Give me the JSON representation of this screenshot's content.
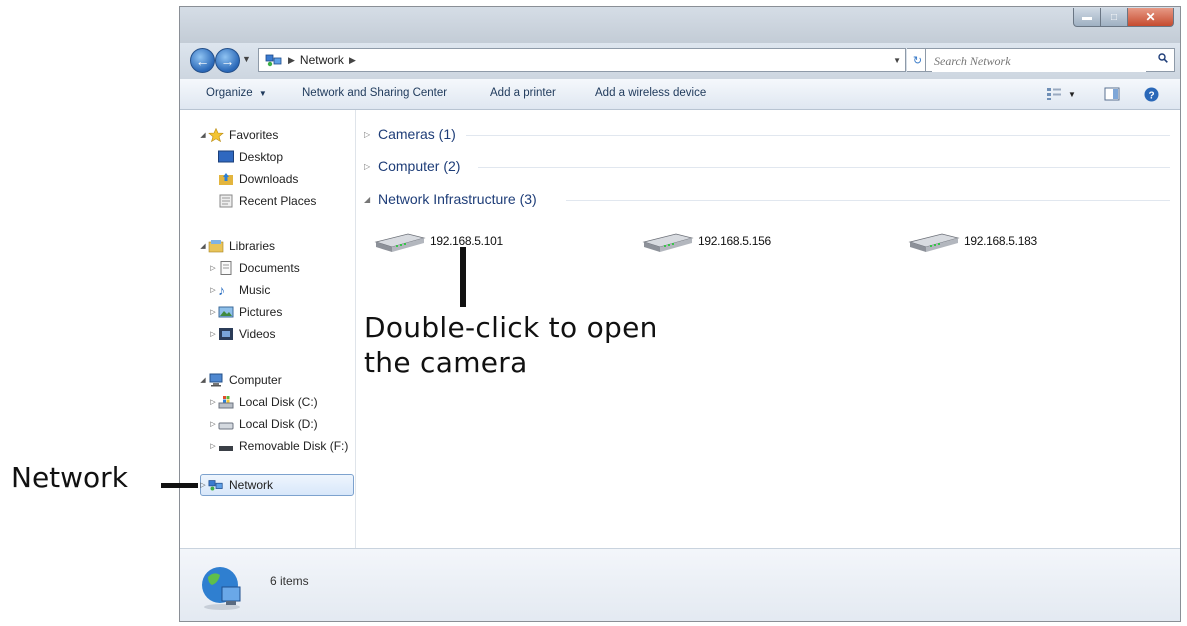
{
  "window": {
    "address": {
      "location": "Network"
    },
    "search": {
      "placeholder": "Search Network"
    },
    "toolbar": {
      "organize": "Organize",
      "network_sharing": "Network and Sharing Center",
      "add_printer": "Add a printer",
      "add_wireless": "Add a wireless device"
    },
    "navpane": {
      "favorites": {
        "label": "Favorites",
        "items": [
          "Desktop",
          "Downloads",
          "Recent Places"
        ]
      },
      "libraries": {
        "label": "Libraries",
        "items": [
          "Documents",
          "Music",
          "Pictures",
          "Videos"
        ]
      },
      "computer": {
        "label": "Computer",
        "items": [
          "Local Disk (C:)",
          "Local Disk (D:)",
          "Removable Disk (F:)"
        ]
      },
      "network": "Network"
    },
    "content": {
      "groups": [
        {
          "label": "Cameras (1)",
          "expanded": false
        },
        {
          "label": "Computer (2)",
          "expanded": false
        },
        {
          "label": "Network Infrastructure (3)",
          "expanded": true
        }
      ],
      "devices": [
        "192.168.5.101",
        "192.168.5.156",
        "192.168.5.183"
      ]
    },
    "details": {
      "count": "6 items"
    }
  },
  "annotations": {
    "open_camera": [
      "Double-click to open",
      "the camera"
    ],
    "network": "Network"
  },
  "icons": {
    "back": "back-arrow-icon",
    "forward": "forward-arrow-icon",
    "search": "search-icon",
    "router": "router-icon",
    "globe": "network-globe-icon"
  },
  "colors": {
    "accent": "#2a68b8",
    "group_header": "#1e3d78",
    "close_button": "#c64b2f"
  }
}
